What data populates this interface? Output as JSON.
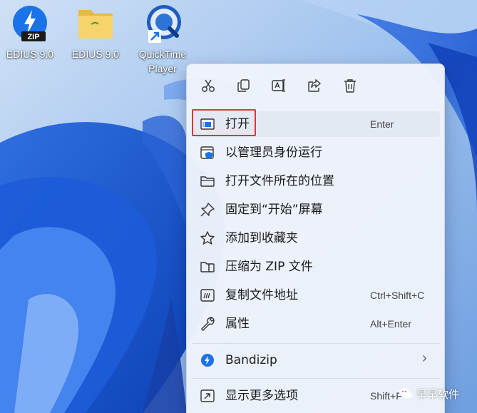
{
  "desktop": {
    "icons": [
      {
        "label": "EDIUS 9.0",
        "icon": "zip-archive-icon",
        "badge": "ZIP"
      },
      {
        "label": "EDIUS 9.0",
        "icon": "folder-icon"
      },
      {
        "label": "QuickTime Player",
        "icon": "quicktime-icon"
      }
    ]
  },
  "menu": {
    "toolbar": [
      "cut-icon",
      "copy-icon",
      "rename-icon",
      "share-icon",
      "delete-icon"
    ],
    "items": [
      {
        "label": "打开",
        "shortcut": "Enter",
        "icon": "open-window-icon"
      },
      {
        "label": "以管理员身份运行",
        "shortcut": "",
        "icon": "admin-shield-icon"
      },
      {
        "label": "打开文件所在的位置",
        "shortcut": "",
        "icon": "folder-outline-icon"
      },
      {
        "label": "固定到“开始”屏幕",
        "shortcut": "",
        "icon": "pin-icon"
      },
      {
        "label": "添加到收藏夹",
        "shortcut": "",
        "icon": "star-icon"
      },
      {
        "label": "压缩为 ZIP 文件",
        "shortcut": "",
        "icon": "zip-folder-icon"
      },
      {
        "label": "复制文件地址",
        "shortcut": "Ctrl+Shift+C",
        "icon": "copy-path-icon"
      },
      {
        "label": "属性",
        "shortcut": "Alt+Enter",
        "icon": "wrench-icon"
      },
      {
        "label": "Bandizip",
        "icon": "bandizip-icon",
        "submenu_arrow": "›"
      },
      {
        "label": "显示更多选项",
        "shortcut": "Shift+F",
        "icon": "more-options-icon"
      }
    ]
  },
  "watermark": {
    "text": "早早软件"
  },
  "colors": {
    "accent": "#1a73e8",
    "highlight_border": "#e03434",
    "menu_bg": "#eef3fb"
  }
}
